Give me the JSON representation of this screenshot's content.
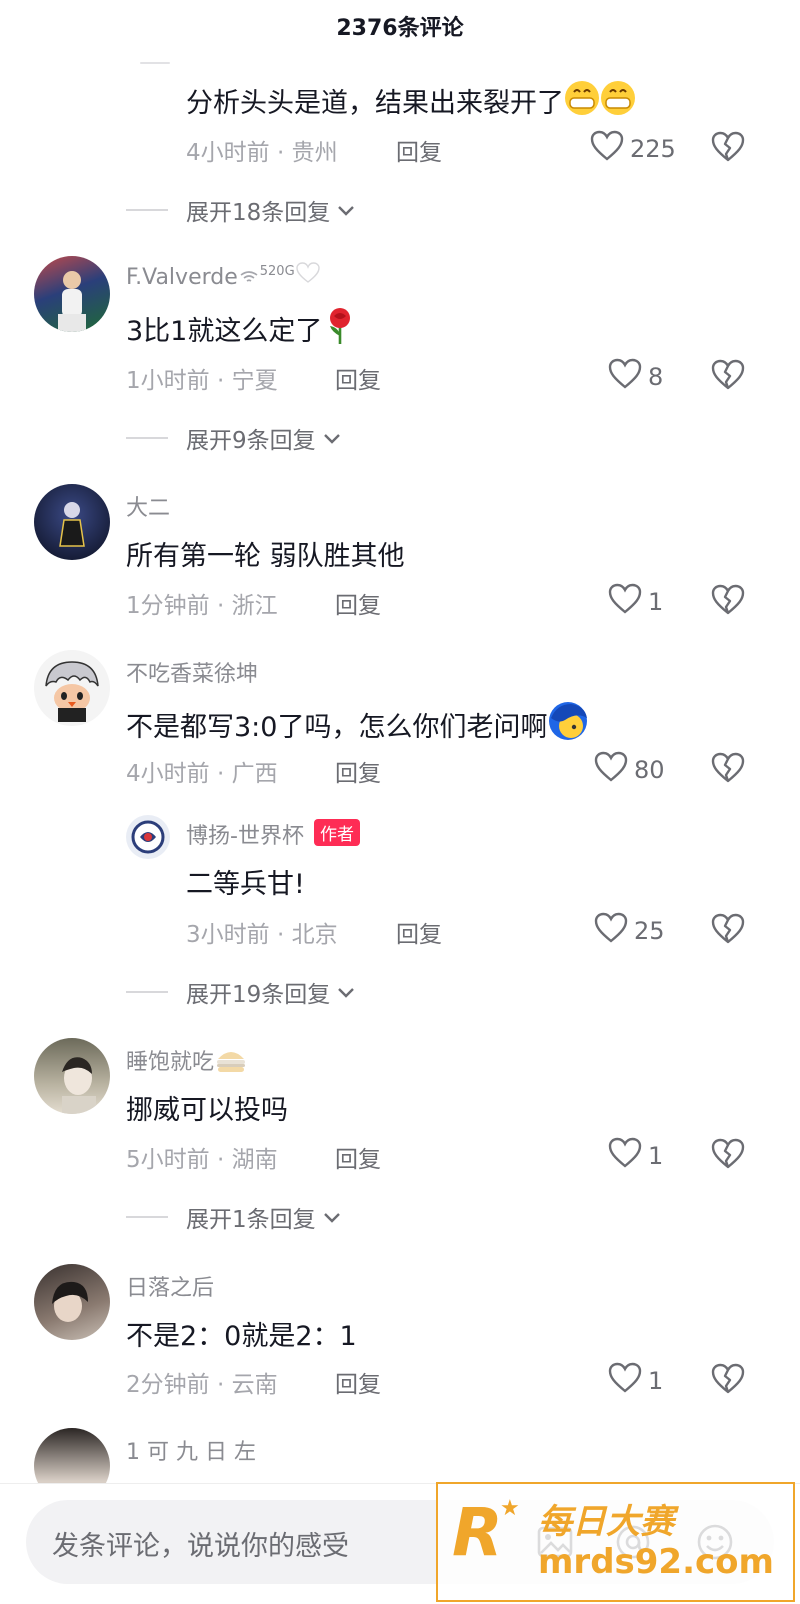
{
  "header": {
    "title": "2376条评论"
  },
  "comments": [
    {
      "text": "分析头头是道，结果出来裂开了",
      "time": "4小时前 · 贵州",
      "reply_label": "回复",
      "likes": "225",
      "expand": "展开18条回复"
    },
    {
      "user": "F.Valverde",
      "badge": "520G",
      "text": "3比1就这么定了",
      "time": "1小时前 · 宁夏",
      "reply_label": "回复",
      "likes": "8",
      "expand": "展开9条回复"
    },
    {
      "user": "大二",
      "text": "所有第一轮 弱队胜其他",
      "time": "1分钟前 · 浙江",
      "reply_label": "回复",
      "likes": "1"
    },
    {
      "user": "不吃香菜徐坤",
      "text": "不是都写3:0了吗，怎么你们老问啊",
      "time": "4小时前 · 广西",
      "reply_label": "回复",
      "likes": "80",
      "sub_reply": {
        "user": "博扬-世界杯",
        "tag": "作者",
        "text": "二等兵甘!",
        "time": "3小时前 · 北京",
        "reply_label": "回复",
        "likes": "25"
      },
      "expand": "展开19条回复"
    },
    {
      "user": "睡饱就吃",
      "text": "挪威可以投吗",
      "time": "5小时前 · 湖南",
      "reply_label": "回复",
      "likes": "1",
      "expand": "展开1条回复"
    },
    {
      "user": "日落之后",
      "text": "不是2：0就是2：1",
      "time": "2分钟前 · 云南",
      "reply_label": "回复",
      "likes": "1"
    },
    {
      "user": "1 可 九 日 左"
    }
  ],
  "input": {
    "placeholder": "发条评论，说说你的感受"
  },
  "watermark": {
    "brand": "每日大赛",
    "site": "mrds92.com",
    "logo_letter": "R"
  },
  "icons": {
    "like": "heart-outline-icon",
    "dislike": "broken-heart-icon",
    "expand": "chevron-down-icon",
    "image": "image-icon",
    "mention": "at-icon",
    "emoji": "smiley-icon"
  },
  "colors": {
    "author_tag": "#fe2c55",
    "text": "#161823",
    "meta": "#a5a6ac",
    "watermark": "#f0a62b"
  }
}
